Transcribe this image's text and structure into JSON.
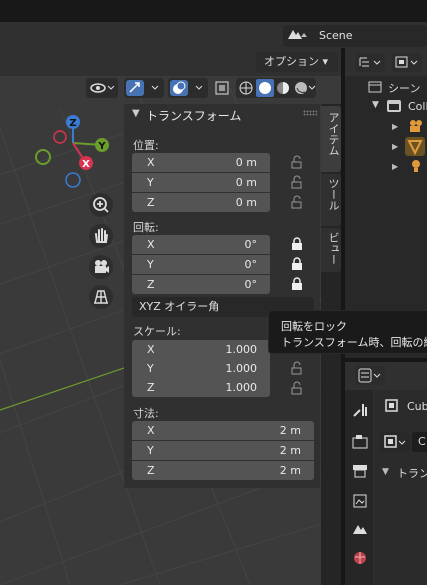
{
  "header": {
    "scene_label": "Scene",
    "options_label": "オプション ▾"
  },
  "npanel": {
    "section_title": "トランスフォーム",
    "location": {
      "label": "位置:",
      "rows": [
        {
          "axis": "X",
          "value": "0 m"
        },
        {
          "axis": "Y",
          "value": "0 m"
        },
        {
          "axis": "Z",
          "value": "0 m"
        }
      ]
    },
    "rotation": {
      "label": "回転:",
      "rows": [
        {
          "axis": "X",
          "value": "0°"
        },
        {
          "axis": "Y",
          "value": "0°"
        },
        {
          "axis": "Z",
          "value": "0°"
        }
      ],
      "mode": "XYZ オイラー角"
    },
    "scale": {
      "label": "スケール:",
      "rows": [
        {
          "axis": "X",
          "value": "1.000"
        },
        {
          "axis": "Y",
          "value": "1.000"
        },
        {
          "axis": "Z",
          "value": "1.000"
        }
      ]
    },
    "dimensions": {
      "label": "寸法:",
      "rows": [
        {
          "axis": "X",
          "value": "2 m"
        },
        {
          "axis": "Y",
          "value": "2 m"
        },
        {
          "axis": "Z",
          "value": "2 m"
        }
      ]
    },
    "tabs": [
      "アイテム",
      "ツール",
      "ビュー"
    ]
  },
  "tooltip": {
    "title": "回転をロック",
    "description": "トランスフォーム時、回転の編"
  },
  "outliner": {
    "root_label": "シーン",
    "collection_label": "Coll"
  },
  "properties": {
    "object_name": "Cub",
    "data_label": "C",
    "section_label": "トラン"
  },
  "gizmo": {
    "x_label": "X",
    "y_label": "Y",
    "z_label": "Z"
  }
}
